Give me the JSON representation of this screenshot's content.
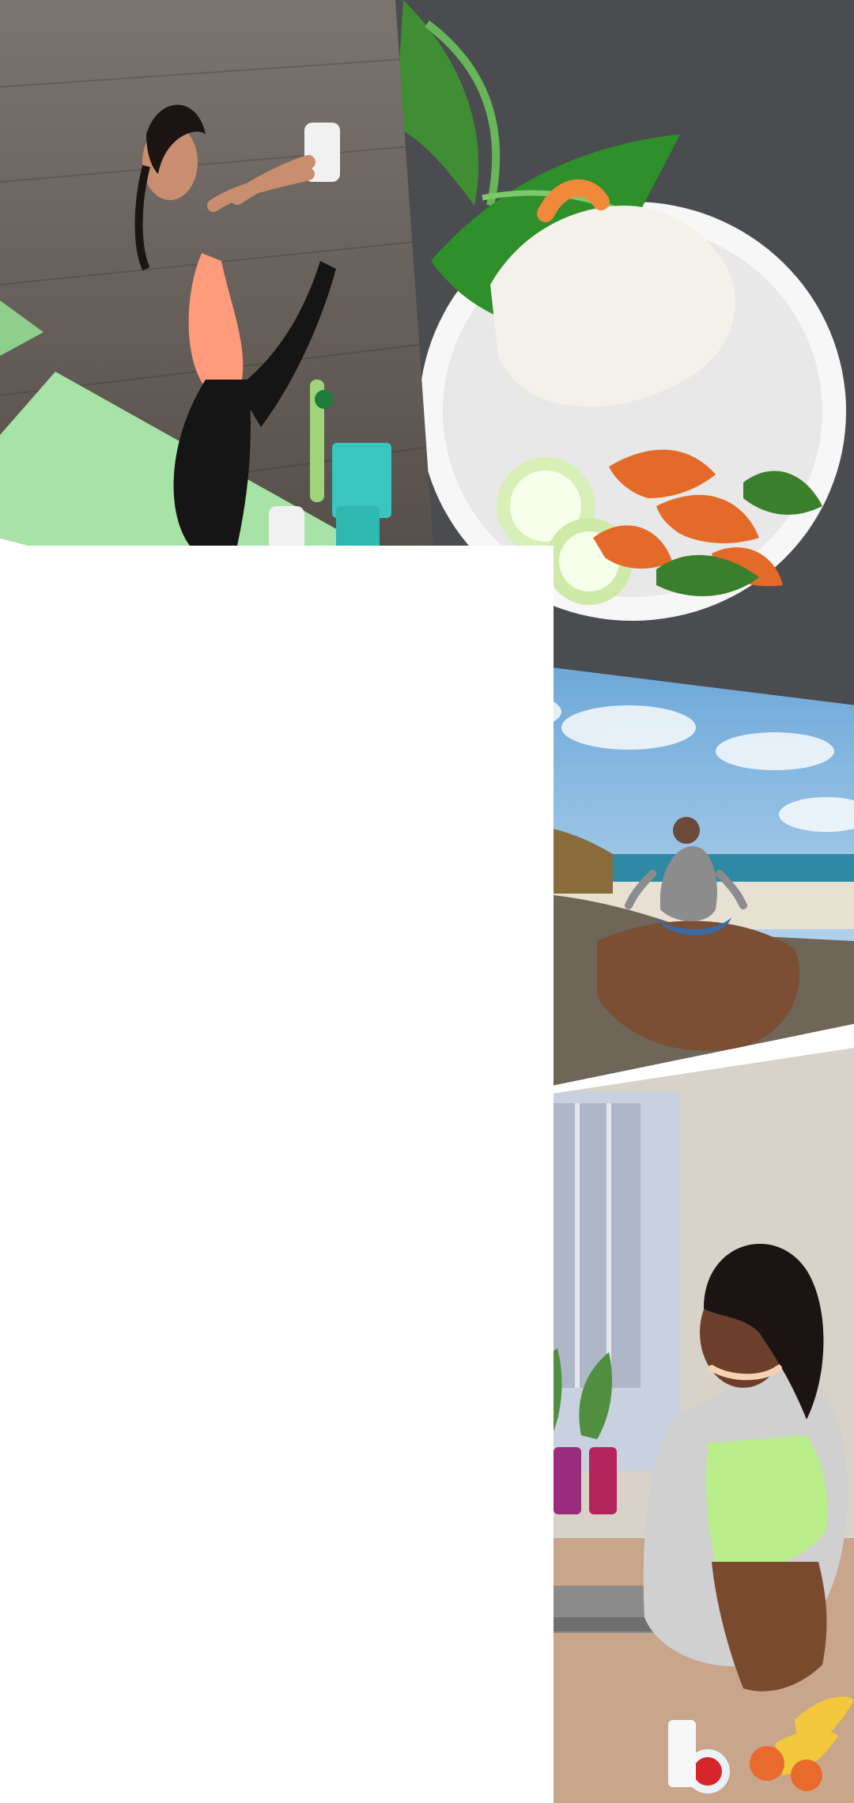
{
  "screen": {
    "background": "#ffffff"
  },
  "collage": {
    "tiles": [
      {
        "id": "yoga",
        "icon": "yoga-photo",
        "accent": "#ff9a7a"
      },
      {
        "id": "food",
        "icon": "shrimp-rice-bowl-photo",
        "accent": "#f08a3a"
      },
      {
        "id": "beach",
        "icon": "beach-meditation-photo",
        "accent": "#5fa7d6"
      },
      {
        "id": "kitchen",
        "icon": "kitchen-cooking-photo",
        "accent": "#b9ee8a"
      }
    ]
  }
}
